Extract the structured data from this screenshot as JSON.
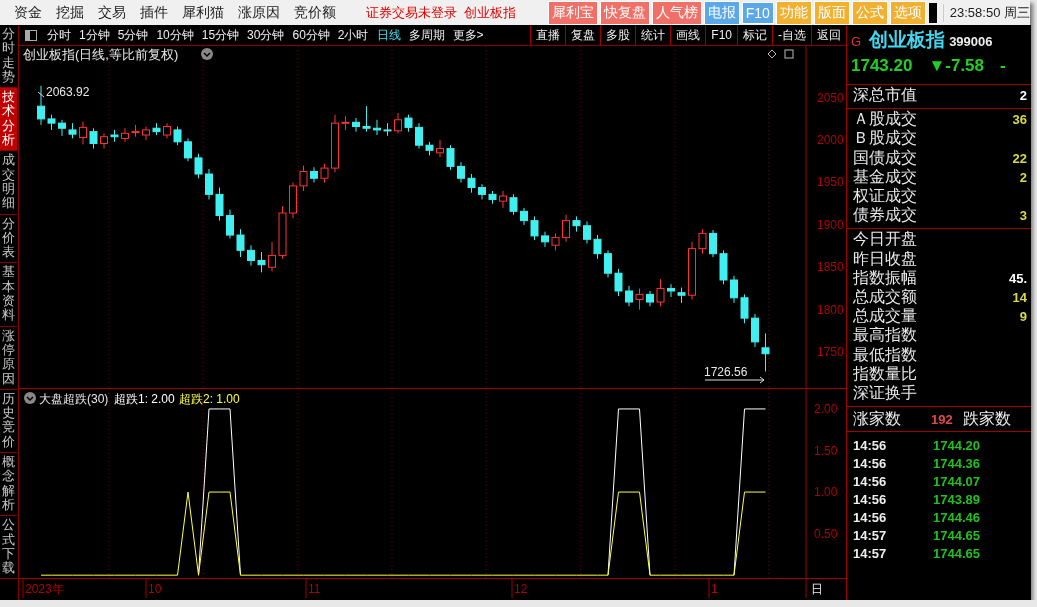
{
  "menu": [
    "资金",
    "挖掘",
    "交易",
    "插件",
    "犀利猫",
    "涨原因",
    "竞价额"
  ],
  "notices": [
    "证券交易未登录",
    "创业板指"
  ],
  "quick_buttons": [
    {
      "label": "犀利宝",
      "color": "#f07068"
    },
    {
      "label": "快复盘",
      "color": "#f07068"
    },
    {
      "label": "人气榜",
      "color": "#f07068"
    },
    {
      "label": "电报",
      "color": "#5aa8e8"
    },
    {
      "label": "F10",
      "color": "#5aa8e8"
    },
    {
      "label": "功能",
      "color": "#f0b030"
    },
    {
      "label": "版面",
      "color": "#f0b030"
    },
    {
      "label": "公式",
      "color": "#f0b030"
    },
    {
      "label": "选项",
      "color": "#f0b030"
    }
  ],
  "clock": "23:58:50 周三",
  "side_tabs": [
    {
      "label": "分时走势",
      "selected": false
    },
    {
      "label": "技术分析",
      "selected": true
    },
    {
      "label": "成交明细",
      "selected": false
    },
    {
      "label": "分价表",
      "selected": false
    },
    {
      "label": "基本资料",
      "selected": false
    },
    {
      "label": "涨停原因",
      "selected": false
    },
    {
      "label": "历史竞价",
      "selected": false
    },
    {
      "label": "概念解析",
      "selected": false
    },
    {
      "label": "公式下载",
      "selected": false
    }
  ],
  "periods": [
    {
      "label": "分时",
      "selected": false
    },
    {
      "label": "1分钟",
      "selected": false
    },
    {
      "label": "5分钟",
      "selected": false
    },
    {
      "label": "10分钟",
      "selected": false
    },
    {
      "label": "15分钟",
      "selected": false
    },
    {
      "label": "30分钟",
      "selected": false
    },
    {
      "label": "60分钟",
      "selected": false
    },
    {
      "label": "2小时",
      "selected": false
    },
    {
      "label": "日线",
      "selected": true
    },
    {
      "label": "多周期",
      "selected": false
    },
    {
      "label": "更多>",
      "selected": false
    }
  ],
  "tools": [
    "直播",
    "复盘",
    "多股",
    "统计",
    "画线",
    "F10",
    "标记",
    "-自选",
    "返回"
  ],
  "chart": {
    "title": "创业板指(日线,等比前复权)",
    "high_mark": "2063.92",
    "low_mark": "1726.56",
    "chart_data": {
      "type": "candlestick",
      "ylim": [
        1707,
        2111
      ],
      "yticks": [
        {
          "value": 2050,
          "label": "2050"
        },
        {
          "value": 2000,
          "label": "2000"
        },
        {
          "value": 1950,
          "label": "1950"
        },
        {
          "value": 1900,
          "label": "1900"
        },
        {
          "value": 1850,
          "label": "1850"
        },
        {
          "value": 1800,
          "label": "1800"
        },
        {
          "value": 1750,
          "label": "1750"
        }
      ],
      "ohlc": [
        [
          2040,
          2064,
          2018,
          2025
        ],
        [
          2025,
          2030,
          2012,
          2020
        ],
        [
          2020,
          2024,
          2005,
          2014
        ],
        [
          2012,
          2020,
          2002,
          2007
        ],
        [
          2003,
          2022,
          1995,
          2015
        ],
        [
          2010,
          2014,
          1990,
          1996
        ],
        [
          1996,
          2008,
          1990,
          2004
        ],
        [
          2006,
          2012,
          1998,
          2004
        ],
        [
          2002,
          2014,
          1998,
          2008
        ],
        [
          2010,
          2018,
          2004,
          2010
        ],
        [
          2006,
          2016,
          2000,
          2012
        ],
        [
          2014,
          2020,
          2006,
          2010
        ],
        [
          2006,
          2020,
          2002,
          2016
        ],
        [
          2012,
          2016,
          1994,
          1998
        ],
        [
          1998,
          2002,
          1975,
          1979
        ],
        [
          1979,
          1984,
          1955,
          1960
        ],
        [
          1960,
          1966,
          1930,
          1936
        ],
        [
          1936,
          1944,
          1905,
          1911
        ],
        [
          1911,
          1918,
          1884,
          1888
        ],
        [
          1888,
          1895,
          1862,
          1870
        ],
        [
          1870,
          1876,
          1852,
          1858
        ],
        [
          1858,
          1868,
          1844,
          1853
        ],
        [
          1850,
          1880,
          1845,
          1864
        ],
        [
          1864,
          1922,
          1860,
          1914
        ],
        [
          1914,
          1950,
          1908,
          1946
        ],
        [
          1946,
          1970,
          1940,
          1963
        ],
        [
          1963,
          1968,
          1950,
          1955
        ],
        [
          1955,
          1972,
          1950,
          1967
        ],
        [
          1967,
          2030,
          1962,
          2020
        ],
        [
          2020,
          2028,
          2012,
          2021
        ],
        [
          2021,
          2026,
          2010,
          2016
        ],
        [
          2016,
          2040,
          2010,
          2014
        ],
        [
          2014,
          2024,
          2006,
          2012
        ],
        [
          2012,
          2020,
          2005,
          2011
        ],
        [
          2011,
          2032,
          2008,
          2024
        ],
        [
          2026,
          2030,
          2010,
          2015
        ],
        [
          2015,
          2020,
          1990,
          1994
        ],
        [
          1994,
          1998,
          1982,
          1988
        ],
        [
          1985,
          2000,
          1980,
          1990
        ],
        [
          1990,
          1994,
          1965,
          1969
        ],
        [
          1969,
          1974,
          1950,
          1955
        ],
        [
          1955,
          1960,
          1938,
          1944
        ],
        [
          1944,
          1948,
          1930,
          1936
        ],
        [
          1936,
          1940,
          1925,
          1930
        ],
        [
          1928,
          1940,
          1920,
          1934
        ],
        [
          1932,
          1936,
          1912,
          1916
        ],
        [
          1916,
          1920,
          1900,
          1905
        ],
        [
          1905,
          1910,
          1882,
          1887
        ],
        [
          1887,
          1892,
          1874,
          1880
        ],
        [
          1876,
          1890,
          1870,
          1885
        ],
        [
          1885,
          1912,
          1880,
          1905
        ],
        [
          1905,
          1910,
          1892,
          1899
        ],
        [
          1899,
          1904,
          1878,
          1883
        ],
        [
          1883,
          1888,
          1860,
          1866
        ],
        [
          1866,
          1870,
          1838,
          1843
        ],
        [
          1843,
          1848,
          1816,
          1822
        ],
        [
          1822,
          1828,
          1804,
          1809
        ],
        [
          1812,
          1825,
          1800,
          1818
        ],
        [
          1818,
          1822,
          1804,
          1809
        ],
        [
          1809,
          1836,
          1804,
          1825
        ],
        [
          1825,
          1830,
          1815,
          1822
        ],
        [
          1820,
          1826,
          1808,
          1817
        ],
        [
          1817,
          1880,
          1812,
          1872
        ],
        [
          1872,
          1895,
          1866,
          1890
        ],
        [
          1890,
          1894,
          1862,
          1866
        ],
        [
          1866,
          1870,
          1830,
          1835
        ],
        [
          1835,
          1840,
          1808,
          1814
        ],
        [
          1814,
          1818,
          1784,
          1790
        ],
        [
          1790,
          1795,
          1756,
          1762
        ],
        [
          1755,
          1772,
          1727,
          1748
        ]
      ]
    },
    "indicator": {
      "title": "大盘超跌(30)",
      "legend": [
        {
          "label": "超跌1: 2.00",
          "color": "#ffffff"
        },
        {
          "label": "超跌2: 1.00",
          "color": "#ffff40"
        }
      ],
      "chart_data": {
        "type": "line",
        "ylim": [
          -0.04,
          2.24
        ],
        "yticks": [
          {
            "value": 2,
            "label": "2.00"
          },
          {
            "value": 1.5,
            "label": "1.50"
          },
          {
            "value": 1,
            "label": "1.00"
          },
          {
            "value": 0.5,
            "label": "0.50"
          }
        ],
        "series": [
          {
            "color": "#ffffff",
            "values": [
              null,
              null,
              null,
              null,
              null,
              null,
              null,
              null,
              null,
              null,
              null,
              null,
              null,
              null,
              null,
              0,
              2,
              2,
              2,
              0,
              null,
              null,
              null,
              null,
              null,
              null,
              null,
              null,
              null,
              null,
              null,
              null,
              null,
              null,
              null,
              null,
              null,
              null,
              null,
              null,
              null,
              null,
              null,
              null,
              null,
              null,
              null,
              null,
              null,
              null,
              null,
              null,
              null,
              null,
              0,
              2,
              2,
              2,
              0,
              null,
              null,
              null,
              null,
              null,
              null,
              null,
              0,
              2,
              2,
              2
            ]
          },
          {
            "color": "#ffff40",
            "values": [
              0,
              0,
              0,
              0,
              0,
              0,
              0,
              0,
              0,
              0,
              0,
              0,
              0,
              0,
              1,
              0,
              1,
              1,
              1,
              0,
              0,
              0,
              0,
              0,
              0,
              0,
              0,
              0,
              0,
              0,
              0,
              0,
              0,
              0,
              0,
              0,
              0,
              0,
              0,
              0,
              0,
              0,
              0,
              0,
              0,
              0,
              0,
              0,
              0,
              0,
              0,
              0,
              0,
              0,
              0,
              1,
              1,
              1,
              0,
              0,
              0,
              0,
              0,
              0,
              0,
              0,
              0,
              1,
              1,
              1
            ]
          }
        ]
      }
    },
    "xlabels": [
      "2023年",
      "10",
      "11",
      "12",
      "1"
    ],
    "period_tag": "日"
  },
  "quote": {
    "badge": "G",
    "name": "创业板指",
    "code": "399006",
    "price": "1743.20",
    "change": "▼-7.58",
    "change_pct": "-",
    "groups": [
      [
        {
          "label": "深总市值",
          "value": "2",
          "color": "#ffffff"
        }
      ],
      [
        {
          "label": "Ａ股成交",
          "value": "36",
          "color": "#d8d848"
        },
        {
          "label": "Ｂ股成交"
        },
        {
          "label": "国债成交",
          "value": "22",
          "color": "#d8d848"
        },
        {
          "label": "基金成交",
          "value": "2",
          "color": "#d8d848"
        },
        {
          "label": "权证成交"
        },
        {
          "label": "债券成交",
          "value": "3",
          "color": "#d8d848"
        }
      ],
      [
        {
          "label": "今日开盘"
        },
        {
          "label": "昨日收盘"
        },
        {
          "label": "指数振幅",
          "value": "45.",
          "color": "#ffffff"
        },
        {
          "label": "总成交额",
          "value": "14",
          "color": "#d8d848"
        },
        {
          "label": "总成交量",
          "value": "9",
          "color": "#d8d848"
        },
        {
          "label": "最高指数"
        },
        {
          "label": "最低指数"
        },
        {
          "label": "指数量比"
        },
        {
          "label": "深证换手"
        }
      ]
    ],
    "breadth": {
      "up_label": "涨家数",
      "up_count": "192",
      "down_label": "跌家数"
    },
    "ticks": [
      {
        "time": "14:56",
        "price": "1744.20"
      },
      {
        "time": "14:56",
        "price": "1744.36"
      },
      {
        "time": "14:56",
        "price": "1744.07"
      },
      {
        "time": "14:56",
        "price": "1743.89"
      },
      {
        "time": "14:56",
        "price": "1744.46"
      },
      {
        "time": "14:57",
        "price": "1744.65"
      },
      {
        "time": "14:57",
        "price": "1744.65"
      }
    ]
  }
}
